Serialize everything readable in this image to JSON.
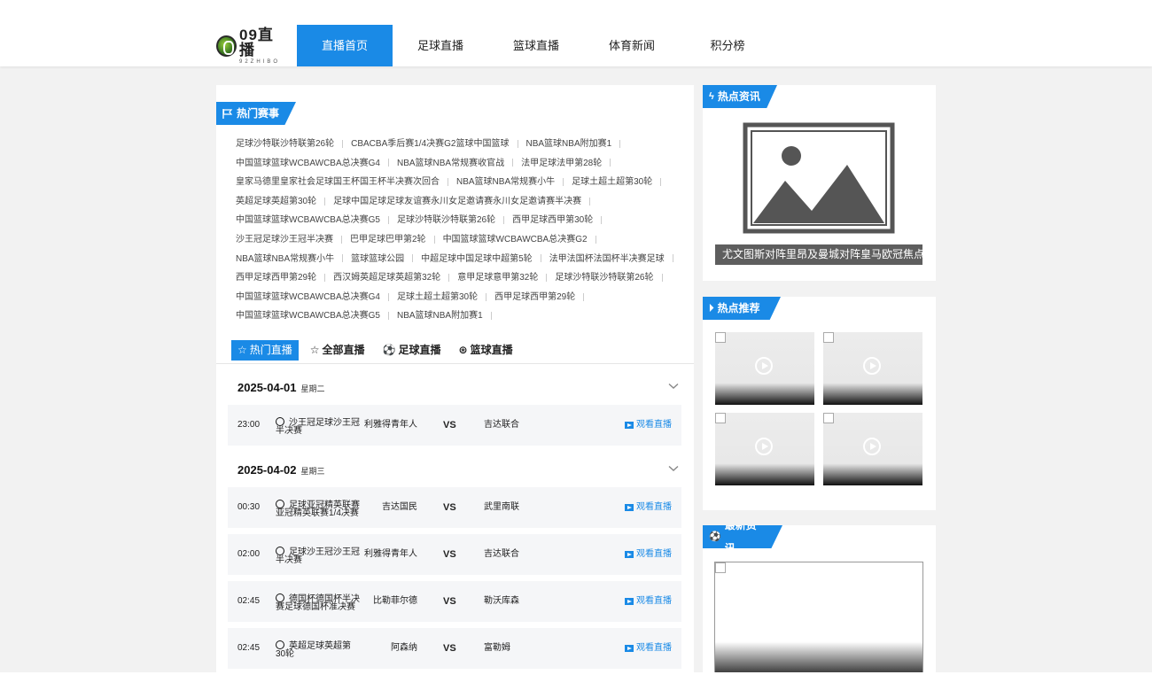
{
  "header": {
    "logo_text": "09直播",
    "logo_sub": "92ZHIBO",
    "nav": [
      {
        "label": "直播首页",
        "active": true
      },
      {
        "label": "足球直播",
        "active": false
      },
      {
        "label": "篮球直播",
        "active": false
      },
      {
        "label": "体育新闻",
        "active": false
      },
      {
        "label": "积分榜",
        "active": false
      }
    ]
  },
  "hot_events": {
    "title": "热门赛事",
    "rows": [
      [
        "足球沙特联沙特联第26轮",
        "CBACBA季后赛1/4决赛G2篮球中国篮球",
        "NBA篮球NBA附加赛1"
      ],
      [
        "中国篮球篮球WCBAWCBA总决赛G4",
        "NBA篮球NBA常规赛收官战",
        "法甲足球法甲第28轮"
      ],
      [
        "皇家马德里皇家社会足球国王杯国王杯半决赛次回合",
        "NBA篮球NBA常规赛小牛",
        "足球土超土超第30轮"
      ],
      [
        "英超足球英超第30轮",
        "足球中国足球足球友谊赛永川女足邀请赛永川女足邀请赛半决赛"
      ],
      [
        "中国篮球篮球WCBAWCBA总决赛G5",
        "足球沙特联沙特联第26轮",
        "西甲足球西甲第30轮"
      ],
      [
        "沙王冠足球沙王冠半决赛",
        "巴甲足球巴甲第2轮",
        "中国篮球篮球WCBAWCBA总决赛G2"
      ],
      [
        "NBA篮球NBA常规赛小牛",
        "篮球篮球公园",
        "中超足球中国足球中超第5轮",
        "法甲法国杯法国杯半决赛足球"
      ],
      [
        "西甲足球西甲第29轮",
        "西汉姆英超足球英超第32轮",
        "意甲足球意甲第32轮",
        "足球沙特联沙特联第26轮"
      ],
      [
        "中国篮球篮球WCBAWCBA总决赛G4",
        "足球土超土超第30轮",
        "西甲足球西甲第29轮"
      ],
      [
        "中国篮球篮球WCBAWCBA总决赛G5",
        "NBA篮球NBA附加赛1"
      ]
    ]
  },
  "tabs": [
    {
      "label": "热门直播",
      "icon": "star-icon",
      "active": true
    },
    {
      "label": "全部直播",
      "icon": "star-icon",
      "active": false
    },
    {
      "label": "足球直播",
      "icon": "soccer-ball-icon",
      "active": false
    },
    {
      "label": "篮球直播",
      "icon": "basketball-icon",
      "active": false
    }
  ],
  "days": [
    {
      "date": "2025-04-01",
      "weekday": "星期二",
      "matches": [
        {
          "time": "23:00",
          "league": "沙王冠足球沙王冠半决赛",
          "home": "利雅得青年人",
          "vs": "VS",
          "away": "吉达联合",
          "watch": "观看直播"
        }
      ]
    },
    {
      "date": "2025-04-02",
      "weekday": "星期三",
      "matches": [
        {
          "time": "00:30",
          "league": "足球亚冠精英联赛亚冠精英联赛1/4决赛",
          "home": "吉达国民",
          "vs": "VS",
          "away": "武里南联",
          "watch": "观看直播"
        },
        {
          "time": "02:00",
          "league": "足球沙王冠沙王冠半决赛",
          "home": "利雅得青年人",
          "vs": "VS",
          "away": "吉达联合",
          "watch": "观看直播"
        },
        {
          "time": "02:45",
          "league": "德国杯德国杯半决赛足球德国杯准决赛",
          "home": "比勒菲尔德",
          "vs": "VS",
          "away": "勒沃库森",
          "watch": "观看直播"
        },
        {
          "time": "02:45",
          "league": "英超足球英超第30轮",
          "home": "阿森纳",
          "vs": "VS",
          "away": "富勒姆",
          "watch": "观看直播"
        }
      ]
    }
  ],
  "hot_news": {
    "title": "热点资讯",
    "caption": "尤文图斯对阵里昂及曼城对阵皇马欧冠焦点..."
  },
  "recommend": {
    "title": "热点推荐"
  },
  "latest": {
    "title": "最新资讯"
  },
  "colors": {
    "accent": "#1a8ae6",
    "background": "#f2f2f2"
  }
}
